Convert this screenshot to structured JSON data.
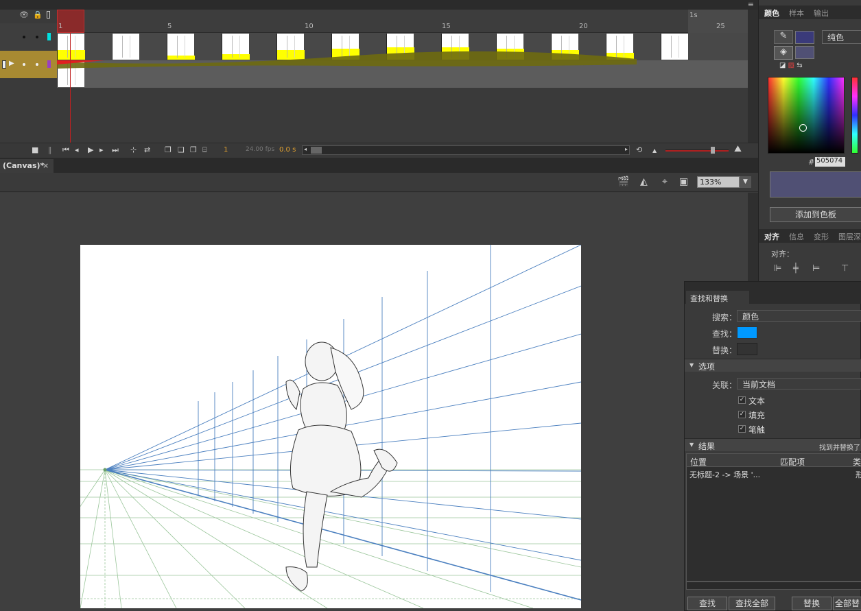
{
  "timeline": {
    "ruler_numbers": [
      "1",
      "5",
      "10",
      "15",
      "20",
      "25"
    ],
    "ruler_seconds": "1s",
    "current_frame": "1",
    "fps": "24.00 fps",
    "time": "0.0 s"
  },
  "document": {
    "tab_title": "(Canvas)*",
    "tab_close": "×",
    "zoom": "133%"
  },
  "color_panel": {
    "tabs": [
      "颜色",
      "样本",
      "输出"
    ],
    "color_type": "纯色",
    "hex_prefix": "#",
    "hex_value": "505074",
    "add_swatch": "添加到色板",
    "fill_color": "#505074",
    "stroke_color": "#3a3a7a"
  },
  "align_panel": {
    "tabs": [
      "对齐",
      "信息",
      "变形",
      "图层深"
    ],
    "align_label": "对齐："
  },
  "find_replace": {
    "tab_title": "查找和替换",
    "search_label": "搜索：",
    "search_value": "颜色",
    "find_label": "查找：",
    "find_color": "#0099ff",
    "replace_label": "替换：",
    "options_section": "选项",
    "scope_label": "关联：",
    "scope_value": "当前文档",
    "checks": [
      "文本",
      "填充",
      "笔触"
    ],
    "results_section": "结果",
    "results_hint": "找到并替换了",
    "columns": [
      "位置",
      "匹配项",
      "类"
    ],
    "result_row": "无标题-2 -> 场景 '...",
    "result_kind": "形",
    "buttons": [
      "查找",
      "查找全部",
      "替换",
      "全部替"
    ]
  }
}
